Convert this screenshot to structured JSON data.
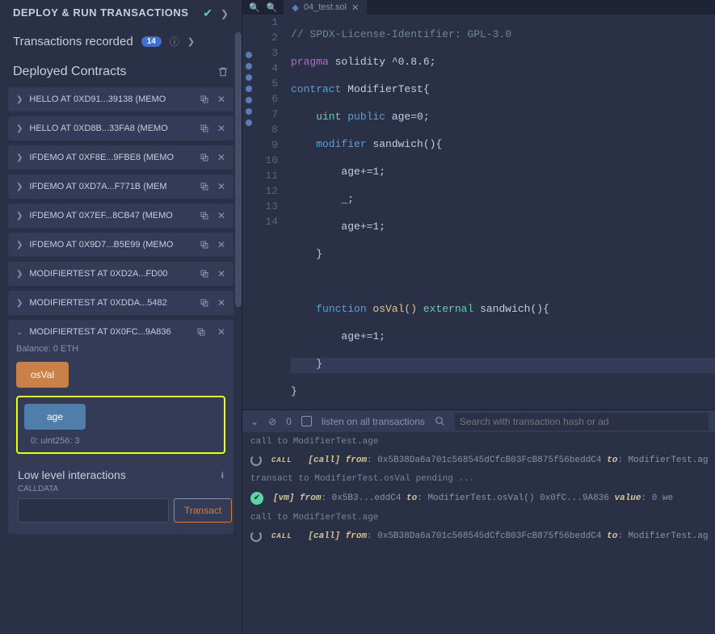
{
  "panel": {
    "title": "DEPLOY & RUN TRANSACTIONS",
    "tx_label": "Transactions recorded",
    "tx_count": "14",
    "deployed_title": "Deployed Contracts",
    "contracts": [
      {
        "label": "HELLO AT 0XD91...39138 (MEMO"
      },
      {
        "label": "HELLO AT 0XD8B...33FA8 (MEMO"
      },
      {
        "label": "IFDEMO AT 0XF8E...9FBE8 (MEMO"
      },
      {
        "label": "IFDEMO AT 0XD7A...F771B (MEM"
      },
      {
        "label": "IFDEMO AT 0X7EF...8CB47 (MEMO"
      },
      {
        "label": "IFDEMO AT 0X9D7...B5E99 (MEMO"
      },
      {
        "label": "MODIFIERTEST AT 0XD2A...FD00"
      },
      {
        "label": "MODIFIERTEST AT 0XDDA...5482"
      }
    ],
    "expanded": {
      "label": "MODIFIERTEST AT 0X0FC...9A836",
      "balance": "Balance: 0 ETH",
      "btn_osval": "osVal",
      "btn_age": "age",
      "age_result": "0: uint256: 3"
    },
    "low_level": {
      "title": "Low level interactions",
      "calldata": "CALLDATA",
      "transact": "Transact"
    }
  },
  "editor": {
    "tab_name": "04_test.sol",
    "lines": {
      "l1": "// SPDX-License-Identifier: GPL-3.0",
      "l2a": "pragma",
      "l2b": " solidity ^0.8.6;",
      "l3a": "contract",
      "l3b": " ModifierTest{",
      "l4a": "    uint",
      "l4b": " public",
      "l4c": " age=0;",
      "l5a": "    modifier",
      "l5b": " sandwich(){",
      "l6": "        age+=1;",
      "l7": "        _;",
      "l8": "        age+=1;",
      "l9": "    }",
      "l10": "",
      "l11a": "    function",
      "l11b": " osVal() ",
      "l11c": "external",
      "l11d": " sandwich(){",
      "l12": "        age+=1;",
      "l13": "    }",
      "l14": "}"
    }
  },
  "terminal": {
    "zero": "0",
    "listen": "listen on all transactions",
    "search_ph": "Search with transaction hash or ad",
    "l1": "call to ModifierTest.age",
    "l2_tag": "CALL",
    "l2_call": "[call]",
    "l2_from": "from",
    "l2_from_v": ": 0x5B38Da6a701c568545dCfcB03FcB875f56beddC4 ",
    "l2_to": "to",
    "l2_to_v": ": ModifierTest.ag",
    "l3": "transact to ModifierTest.osVal pending ...",
    "l4_tag": "[vm]",
    "l4_from": "from",
    "l4_from_v": ": 0x5B3...eddC4 ",
    "l4_to": "to",
    "l4_to_v": ": ModifierTest.osVal() 0x0fC...9A836 ",
    "l4_val": "value",
    "l4_val_v": ": 0 we",
    "l5": "call to ModifierTest.age",
    "l6_tag": "CALL",
    "l6_call": "[call]",
    "l6_from": "from",
    "l6_from_v": ": 0x5B38Da6a701c568545dCfcB03FcB875f56beddC4 ",
    "l6_to": "to",
    "l6_to_v": ": ModifierTest.ag"
  }
}
